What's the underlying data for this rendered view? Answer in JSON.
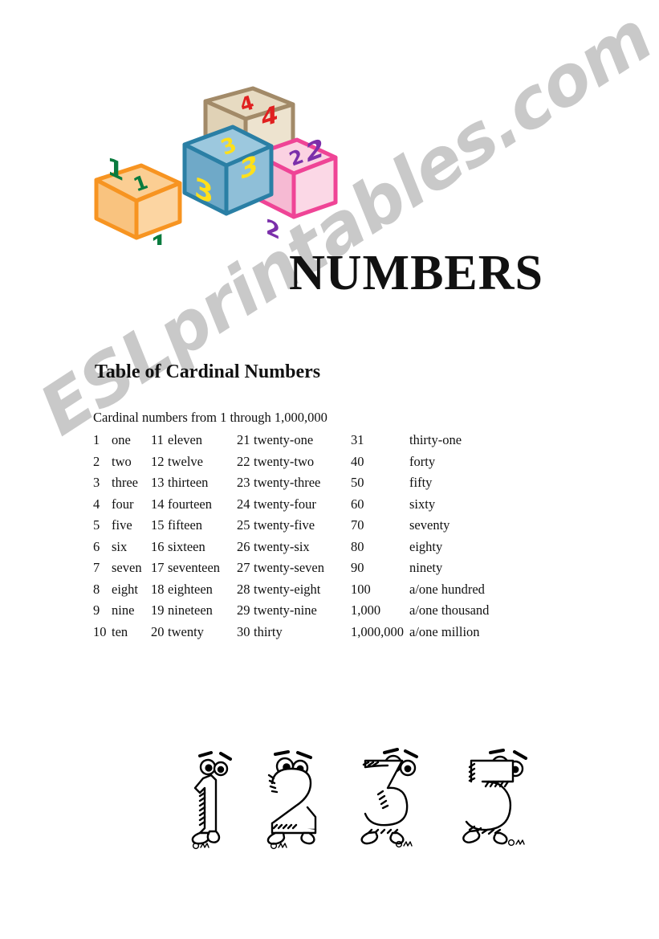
{
  "document": {
    "main_title": "NUMBERS",
    "section_heading": "Table of Cardinal Numbers",
    "intro_line": "Cardinal numbers from 1 through 1,000,000"
  },
  "watermark": {
    "text": "ESLprintables.com",
    "color": "#c9c9c9"
  },
  "blocks_illustration": {
    "name": "toy-alphabet-blocks",
    "blocks": [
      {
        "digit": "1",
        "frame_color": "#F79421",
        "face_color": "#FBCE93",
        "digit_color": "#0A7B3E"
      },
      {
        "digit": "3",
        "frame_color": "#2A7FA5",
        "face_color": "#86BBD6",
        "digit_color": "#FFE01B"
      },
      {
        "digit": "4",
        "frame_color": "#A28A68",
        "face_color": "#E7DBC2",
        "digit_color": "#E02020"
      },
      {
        "digit": "2",
        "frame_color": "#EF4496",
        "face_color": "#FBD2E2",
        "digit_color": "#7B2FAA"
      }
    ]
  },
  "cartoon_figures": {
    "name": "cartoon-number-characters",
    "digits": [
      "1",
      "2",
      "3",
      "5"
    ]
  },
  "table": {
    "columns": [
      "num_1_10",
      "word_1_10",
      "num_11_20",
      "word_11_20",
      "num_21_30",
      "word_21_30",
      "num_tens",
      "word_tens"
    ],
    "rows": [
      [
        "1",
        "one",
        "11",
        "eleven",
        "21",
        "twenty-one",
        "31",
        "thirty-one"
      ],
      [
        "2",
        "two",
        "12",
        "twelve",
        "22",
        "twenty-two",
        "40",
        "forty"
      ],
      [
        "3",
        "three",
        "13",
        "thirteen",
        "23",
        "twenty-three",
        "50",
        "fifty"
      ],
      [
        "4",
        "four",
        "14",
        "fourteen",
        "24",
        "twenty-four",
        "60",
        "sixty"
      ],
      [
        "5",
        "five",
        "15",
        "fifteen",
        "25",
        "twenty-five",
        "70",
        "seventy"
      ],
      [
        "6",
        "six",
        "16",
        "sixteen",
        "26",
        "twenty-six",
        "80",
        "eighty"
      ],
      [
        "7",
        "seven",
        "17",
        "seventeen",
        "27",
        "twenty-seven",
        "90",
        "ninety"
      ],
      [
        "8",
        "eight",
        "18",
        "eighteen",
        "28",
        "twenty-eight",
        "100",
        "a/one hundred"
      ],
      [
        "9",
        "nine",
        "19",
        "nineteen",
        "29",
        "twenty-nine",
        "1,000",
        "a/one thousand"
      ],
      [
        "10",
        "ten",
        "20",
        "twenty",
        "30",
        "thirty",
        "1,000,000",
        "a/one million"
      ]
    ]
  }
}
